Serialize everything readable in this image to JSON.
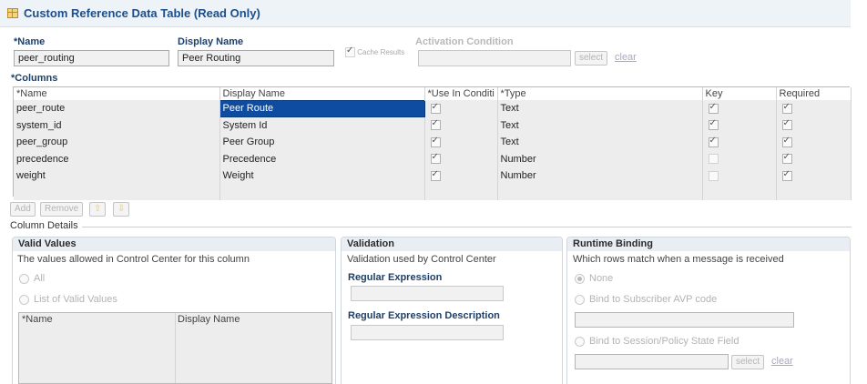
{
  "header": {
    "title": "Custom Reference Data Table (Read Only)"
  },
  "form": {
    "name_label_req": "*",
    "name_label": "Name",
    "name_value": "peer_routing",
    "display_name_label": "Display Name",
    "display_name_value": "Peer Routing",
    "cache_results_label": "Cache Results",
    "activation_label": "Activation Condition",
    "activation_value": "",
    "select_label": "select",
    "clear_label": "clear"
  },
  "columns": {
    "label_req": "*",
    "label": "Columns",
    "headers": [
      "*Name",
      "Display Name",
      "*Use In Conditi",
      "*Type",
      "Key",
      "Required"
    ],
    "rows": [
      {
        "name": "peer_route",
        "display": "Peer Route",
        "use": true,
        "type": "Text",
        "key": true,
        "required": true
      },
      {
        "name": "system_id",
        "display": "System Id",
        "use": true,
        "type": "Text",
        "key": true,
        "required": true
      },
      {
        "name": "peer_group",
        "display": "Peer Group",
        "use": true,
        "type": "Text",
        "key": true,
        "required": true
      },
      {
        "name": "precedence",
        "display": "Precedence",
        "use": true,
        "type": "Number",
        "key": false,
        "required": true
      },
      {
        "name": "weight",
        "display": "Weight",
        "use": true,
        "type": "Number",
        "key": false,
        "required": true
      }
    ],
    "selected_row": 0,
    "buttons": {
      "add": "Add",
      "remove": "Remove",
      "up": "⇧",
      "down": "⇩"
    }
  },
  "column_details": {
    "title": "Column Details",
    "valid_values": {
      "title": "Valid Values",
      "description": "The values allowed in Control Center for this column",
      "options": [
        "All",
        "List of Valid Values"
      ],
      "grid_headers": [
        "*Name",
        "Display Name"
      ]
    },
    "validation": {
      "title": "Validation",
      "description": "Validation used by Control Center",
      "regex_label": "Regular Expression",
      "regex_value": "",
      "regex_desc_label": "Regular Expression Description",
      "regex_desc_value": ""
    },
    "runtime_binding": {
      "title": "Runtime Binding",
      "description": "Which rows match when a message is received",
      "options": [
        "None",
        "Bind to Subscriber AVP code",
        "Bind to Session/Policy State Field"
      ],
      "select_label": "select",
      "clear_label": "clear"
    }
  },
  "figure_number": "215570"
}
